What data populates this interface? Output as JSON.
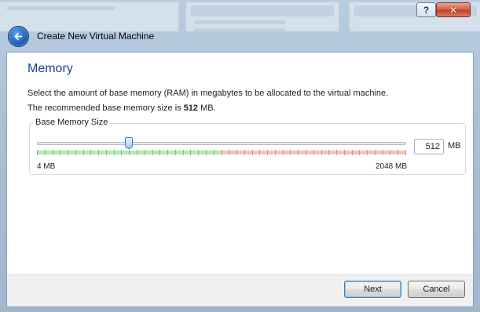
{
  "window": {
    "help_label": "?",
    "close_label": "✕"
  },
  "header": {
    "title": "Create New Virtual Machine",
    "back_icon": "back-arrow-icon"
  },
  "page": {
    "section_title": "Memory",
    "description_line1": "Select the amount of base memory (RAM) in megabytes to be allocated to the virtual machine.",
    "recommended_prefix": "The recommended base memory size is ",
    "recommended_value": "512",
    "recommended_suffix": " MB."
  },
  "memory": {
    "group_title": "Base Memory Size",
    "value": "512",
    "unit": "MB",
    "min_label": "4 MB",
    "max_label": "2048 MB",
    "min_mb": 4,
    "max_mb": 2048,
    "current_mb": 512,
    "safe_fraction": 0.5
  },
  "buttons": {
    "next": "Next",
    "cancel": "Cancel"
  },
  "colors": {
    "title_blue": "#1c3f91",
    "safe_band": "#b7e9b3",
    "warn_band": "#f2c2b9"
  }
}
